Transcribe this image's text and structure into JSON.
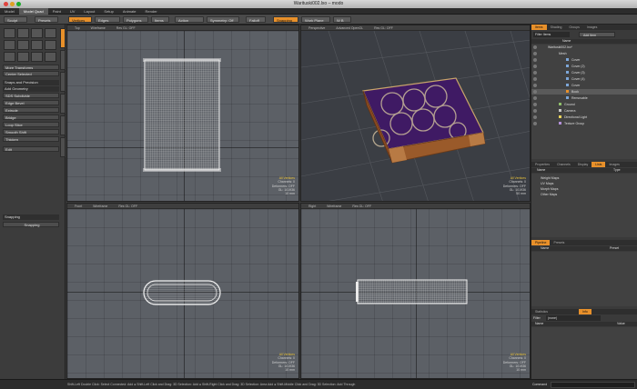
{
  "window": {
    "title": "Warituski002.lxo – modo"
  },
  "menu": [
    "Model",
    "Model Quad",
    "Paint",
    "UV",
    "Layout",
    "Setup",
    "Animate",
    "Render"
  ],
  "menu_active": 1,
  "toolbar": {
    "sculpt": "Sculpt",
    "presets": "Presets",
    "vertices": "Vertices",
    "edges": "Edges",
    "polygons": "Polygons",
    "items": "Items",
    "action_center": "Action Center",
    "symmetry": "Symmetry: Off",
    "falloff": "Falloff",
    "snapping": "Snapping",
    "work_plane": "Work Plane",
    "extra": "W B"
  },
  "left": {
    "transforms": "More Transforms",
    "center": "Center Selected",
    "section": "Snaps and Precision",
    "add_geometry": "Add Geometry",
    "tools": [
      "SDS Subdivide",
      "Edge Bevel",
      "Extrude",
      "Bridge",
      "Loop Slice",
      "Smooth Shift",
      "Thicken"
    ],
    "edit": "Edit",
    "snapping_header": "Snapping",
    "snapping_btn": "Snapping"
  },
  "viewports": [
    {
      "hdr": [
        "Top",
        "Wireframe",
        "Res GL: OFF"
      ],
      "stats": [
        "All Vertices",
        "Channels: 0",
        "Deformers: OFF",
        "GL: 101936",
        "10 mm"
      ]
    },
    {
      "hdr": [
        "Perspective",
        "Advanced OpenGL",
        "Res GL: OFF"
      ],
      "stats": [
        "All Vertices",
        "Channels: 0",
        "Deformers: OFF",
        "GL: 101936",
        "50 mm"
      ]
    },
    {
      "hdr": [
        "Front",
        "Wireframe",
        "Res GL: OFF"
      ],
      "stats": [
        "All Vertices",
        "Channels: 0",
        "Deformers: OFF",
        "GL: 101936",
        "10 mm"
      ]
    },
    {
      "hdr": [
        "Right",
        "Wireframe",
        "Res GL: OFF"
      ],
      "stats": [
        "All Vertices",
        "Channels: 0",
        "Deformers: OFF",
        "GL: 101936",
        "10 mm"
      ]
    }
  ],
  "right": {
    "tabs": [
      "Items",
      "Shading",
      "Groups",
      "Images"
    ],
    "filter": "Filter Items",
    "add_item": "Add Item",
    "col_name": "Name",
    "tree": [
      {
        "label": "Warituski002.lxo*",
        "indent": 1,
        "sel": false
      },
      {
        "label": "Mesh",
        "indent": 2,
        "sel": false
      },
      {
        "label": "Cover",
        "indent": 3,
        "sel": false
      },
      {
        "label": "Cover (2)",
        "indent": 3,
        "sel": false
      },
      {
        "label": "Cover (3)",
        "indent": 3,
        "sel": false
      },
      {
        "label": "Cover (4)",
        "indent": 3,
        "sel": false
      },
      {
        "label": "Cover",
        "indent": 3,
        "sel": false
      },
      {
        "label": "Book",
        "indent": 3,
        "sel": true
      },
      {
        "label": "Removable",
        "indent": 3,
        "sel": false
      },
      {
        "label": "Ground",
        "indent": 2,
        "sel": false
      },
      {
        "label": "Camera",
        "indent": 2,
        "sel": false
      },
      {
        "label": "Directional Light",
        "indent": 2,
        "sel": false
      },
      {
        "label": "Texture Group",
        "indent": 2,
        "sel": false
      }
    ],
    "tabs2": [
      "Properties",
      "Channels",
      "Display",
      "Lists",
      "Images"
    ],
    "list_cols": [
      "Name",
      "Type"
    ],
    "lists": [
      "Weight Maps",
      "UV Maps",
      "Morph Maps",
      "Other Maps"
    ],
    "pipeline_tabs": [
      "Pipeline",
      "Presets"
    ],
    "pipeline_cols": [
      "Name",
      "Preset"
    ],
    "info_tabs": [
      "Statistics",
      "Info"
    ],
    "filter2_label": "Filter",
    "filter2_value": "(none)",
    "info_cols": [
      "Name",
      "Value"
    ]
  },
  "status": {
    "hint": "Shift-Left Double Click: Select Connected: Add ● Shift-Left Click and Drag: 3D Selection: Add ● Shift-Right Click and Drag: 3D Selection: Area Add ● Shift-Middle Click and Drag: 3D Selection: Add Through",
    "command": "Command"
  },
  "colors": {
    "accent": "#e8902a",
    "cover": "#3f1a64",
    "spine": "#9a5a2a"
  }
}
